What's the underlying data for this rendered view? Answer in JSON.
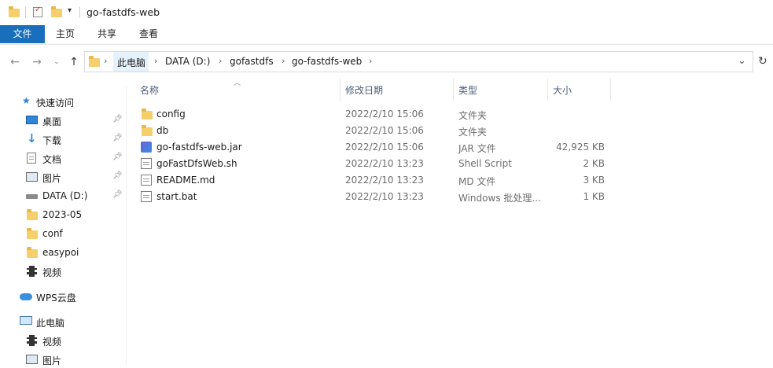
{
  "window": {
    "title": "go-fastdfs-web"
  },
  "ribbon": {
    "tabs": [
      "文件",
      "主页",
      "共享",
      "查看"
    ]
  },
  "address": {
    "crumbs": [
      "此电脑",
      "DATA (D:)",
      "gofastdfs",
      "go-fastdfs-web"
    ]
  },
  "nav": {
    "quick_access": "快速访问",
    "pinned": [
      "桌面",
      "下载",
      "文档",
      "图片",
      "DATA (D:)"
    ],
    "recent": [
      "2023-05",
      "conf",
      "easypoi",
      "视频"
    ],
    "wps": "WPS云盘",
    "this_pc": "此电脑",
    "pc_items": [
      "视频",
      "图片"
    ]
  },
  "columns": {
    "name": "名称",
    "date": "修改日期",
    "type": "类型",
    "size": "大小"
  },
  "files": [
    {
      "name": "config",
      "date": "2022/2/10 15:06",
      "type": "文件夹",
      "size": "",
      "icon": "folder-icon"
    },
    {
      "name": "db",
      "date": "2022/2/10 15:06",
      "type": "文件夹",
      "size": "",
      "icon": "folder-icon"
    },
    {
      "name": "go-fastdfs-web.jar",
      "date": "2022/2/10 15:06",
      "type": "JAR 文件",
      "size": "42,925 KB",
      "icon": "jar-icon"
    },
    {
      "name": "goFastDfsWeb.sh",
      "date": "2022/2/10 13:23",
      "type": "Shell Script",
      "size": "2 KB",
      "icon": "script-icon"
    },
    {
      "name": "README.md",
      "date": "2022/2/10 13:23",
      "type": "MD 文件",
      "size": "3 KB",
      "icon": "document-icon"
    },
    {
      "name": "start.bat",
      "date": "2022/2/10 13:23",
      "type": "Windows 批处理...",
      "size": "1 KB",
      "icon": "script-icon"
    }
  ],
  "colors": {
    "accent": "#1a6fbd",
    "folder": "#f5cf6b"
  }
}
